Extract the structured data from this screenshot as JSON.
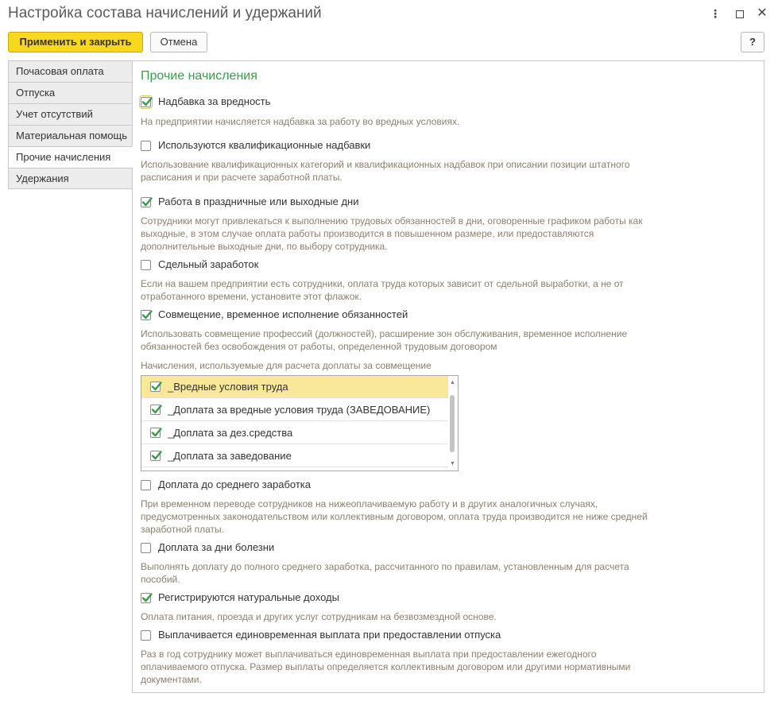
{
  "window": {
    "title": "Настройка состава начислений и удержаний",
    "controls": [
      "more-icon",
      "maximize-icon",
      "close-icon"
    ]
  },
  "toolbar": {
    "apply_close": "Применить и закрыть",
    "cancel": "Отмена",
    "help": "?"
  },
  "tabs": [
    {
      "label": "Почасовая оплата",
      "active": false
    },
    {
      "label": "Отпуска",
      "active": false
    },
    {
      "label": "Учет отсутствий",
      "active": false
    },
    {
      "label": "Материальная помощь",
      "active": false
    },
    {
      "label": "Прочие начисления",
      "active": true
    },
    {
      "label": "Удержания",
      "active": false
    }
  ],
  "section_title": "Прочие начисления",
  "options": [
    {
      "label": "Надбавка за вредность",
      "checked": true,
      "hint": [
        "На предприятии начисляется надбавка за работу во вредных условиях."
      ]
    },
    {
      "label": "Используются квалификационные надбавки",
      "checked": false,
      "hint": [
        "Использование квалификационных категорий и квалификационных надбавок при описании позиции штатного",
        "расписания и при расчете заработной платы."
      ]
    },
    {
      "label": "Работа в праздничные или выходные дни",
      "checked": true,
      "hint": [
        "Сотрудники могут привлекаться к выполнению трудовых обязанностей в дни, оговоренные графиком работы как",
        "выходные, в этом случае оплата работы производится в повышенном размере, или предоставляются",
        "дополнительные выходные дни, по выбору сотрудника."
      ]
    },
    {
      "label": "Сдельный заработок",
      "checked": false,
      "hint": [
        "Если на вашем предприятии есть сотрудники, оплата труда которых зависит от сдельной выработки, а не от",
        "отработанного времени, установите этот флажок."
      ]
    },
    {
      "label": "Совмещение, временное исполнение обязанностей",
      "checked": true,
      "hint": [
        "Использовать совмещение профессий (должностей), расширение зон обслуживания, временное исполнение",
        "обязанностей без освобождения от работы, определенной трудовым договором"
      ]
    },
    {
      "label": "Доплата до среднего заработка",
      "checked": false,
      "hint": [
        "При временном переводе сотрудников на нижеоплачиваемую работу и в других аналогичных случаях,",
        "предусмотренных законодательством или коллективным договором, оплата труда производится не ниже средней",
        "заработной платы."
      ]
    },
    {
      "label": "Доплата за дни болезни",
      "checked": false,
      "hint": [
        "Выполнять доплату до полного среднего заработка, рассчитанного по правилам, установленным для расчета",
        "пособий."
      ]
    },
    {
      "label": "Регистрируются натуральные доходы",
      "checked": true,
      "hint": [
        "Оплата питания, проезда и других услуг сотрудникам на безвозмездной основе."
      ]
    },
    {
      "label": "Выплачивается единовременная выплата при предоставлении отпуска",
      "checked": false,
      "hint": [
        "Раз в год сотруднику может выплачиваться единовременная выплата при предоставлении ежегодного",
        "оплачиваемого отпуска. Размер выплаты определяется коллективным договором или другими нормативными",
        "документами."
      ]
    }
  ],
  "combination_list": {
    "title": "Начисления, используемые для расчета доплаты за совмещение",
    "items": [
      {
        "label": "_Вредные условия труда",
        "checked": true,
        "selected": true
      },
      {
        "label": "_Доплата за вредные условия труда (ЗАВЕДОВАНИЕ)",
        "checked": true,
        "selected": false
      },
      {
        "label": "_Доплата за дез.средства",
        "checked": true,
        "selected": false
      },
      {
        "label": "_Доплата за заведование",
        "checked": true,
        "selected": false
      }
    ]
  },
  "colors": {
    "accent_green": "#3a9c4b",
    "primary_button": "#f7d81f",
    "selected_row": "#f9e79a",
    "hint_text": "#8b7f6a"
  }
}
